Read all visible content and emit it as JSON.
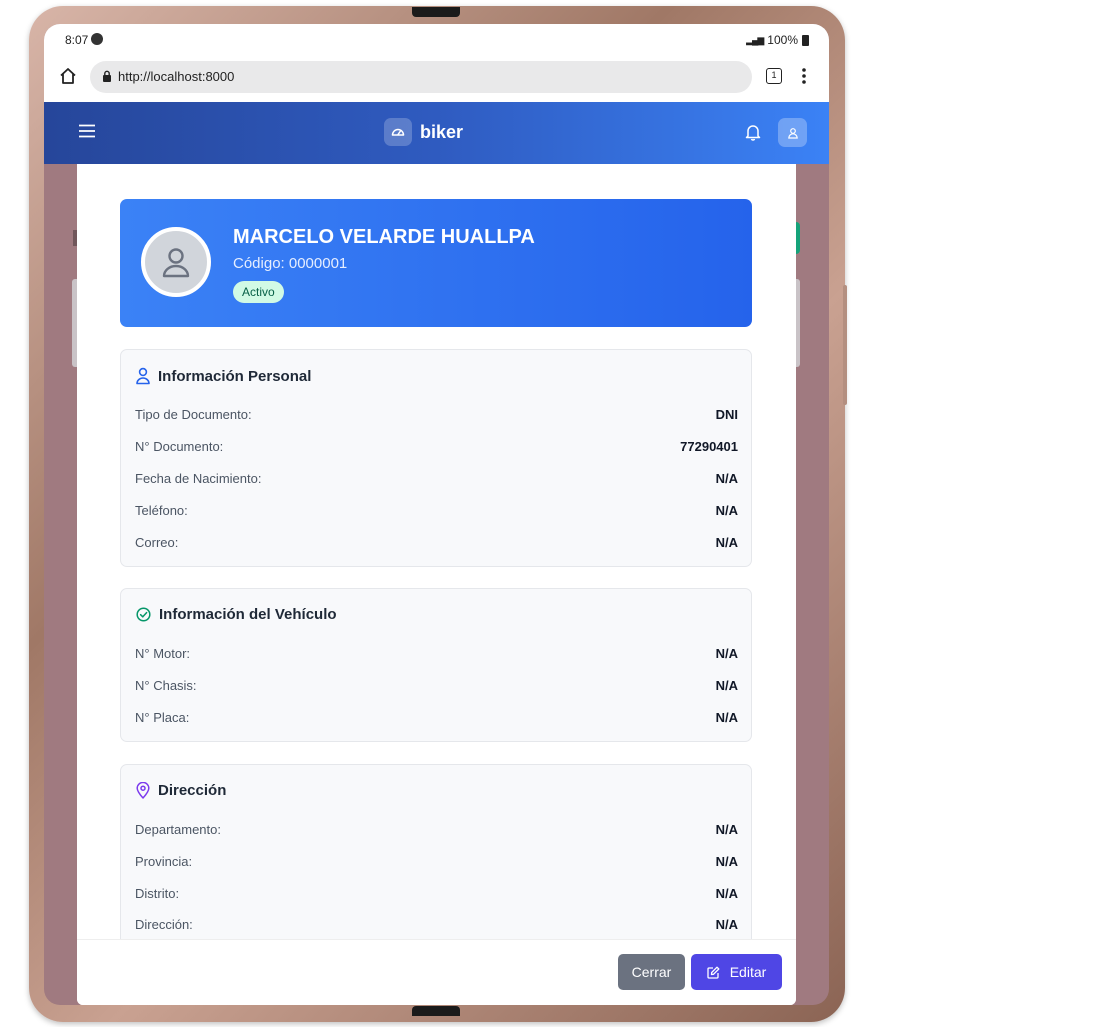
{
  "status_bar": {
    "time": "8:07",
    "battery": "100%"
  },
  "browser": {
    "url": "http://localhost:8000",
    "tab_count": "1"
  },
  "app": {
    "brand": "biker"
  },
  "profile": {
    "name": "MARCELO VELARDE HUALLPA",
    "code": "Código: 0000001",
    "status": "Activo"
  },
  "personal": {
    "title": "Información Personal",
    "rows": [
      {
        "label": "Tipo de Documento:",
        "value": "DNI"
      },
      {
        "label": "N° Documento:",
        "value": "77290401"
      },
      {
        "label": "Fecha de Nacimiento:",
        "value": "N/A"
      },
      {
        "label": "Teléfono:",
        "value": "N/A"
      },
      {
        "label": "Correo:",
        "value": "N/A"
      }
    ]
  },
  "vehicle": {
    "title": "Información del Vehículo",
    "rows": [
      {
        "label": "N° Motor:",
        "value": "N/A"
      },
      {
        "label": "N° Chasis:",
        "value": "N/A"
      },
      {
        "label": "N° Placa:",
        "value": "N/A"
      }
    ]
  },
  "address": {
    "title": "Dirección",
    "rows": [
      {
        "label": "Departamento:",
        "value": "N/A"
      },
      {
        "label": "Provincia:",
        "value": "N/A"
      },
      {
        "label": "Distrito:",
        "value": "N/A"
      },
      {
        "label": "Dirección:",
        "value": "N/A"
      }
    ]
  },
  "footer": {
    "close_label": "Cerrar",
    "edit_label": "Editar"
  },
  "colors": {
    "header_start": "#26469a",
    "header_end": "#3b82f6",
    "profile_gradient_start": "#3b82f6",
    "badge_bg": "#d1fae5",
    "close_button": "#6b7280",
    "edit_button": "#4f46e5",
    "personal_icon": "#2563eb",
    "vehicle_icon": "#059669",
    "address_icon": "#7c3aed"
  },
  "icons": {
    "home": "home-icon",
    "lock": "lock-icon",
    "tabs": "tabs-icon",
    "more": "kebab-icon",
    "menu": "menu-icon",
    "brand": "speedometer-icon",
    "bell": "bell-icon",
    "user": "user-icon",
    "personal": "user-icon",
    "vehicle": "check-circle-icon",
    "address": "map-pin-icon",
    "edit": "edit-icon"
  }
}
